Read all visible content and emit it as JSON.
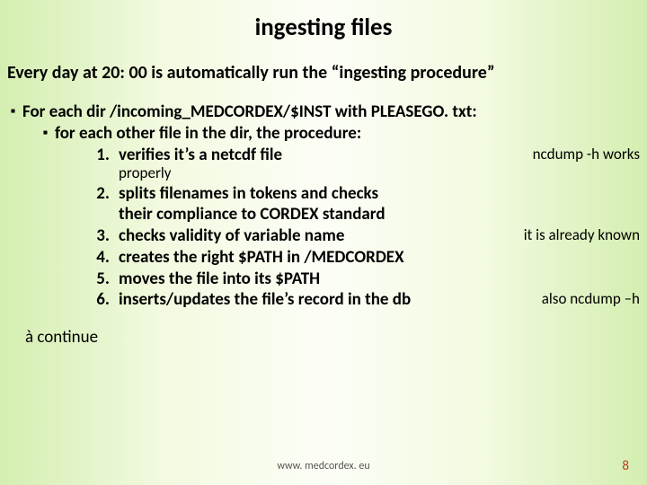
{
  "title": "ingesting files",
  "subtitle": "Every day at 20: 00 is automatically run the “ingesting procedure”",
  "bullet1": "For each dir /incoming_MEDCORDEX/$INST  with PLEASEGO. txt:",
  "bullet2": "for each other file in the dir, the procedure:",
  "items": [
    {
      "n": "1.",
      "text": "verifies it’s a netcdf file",
      "note": "ncdump -h works"
    },
    {
      "n": "2.",
      "text": "splits filenames in tokens and checks",
      "text2": "their compliance to CORDEX standard",
      "note": ""
    },
    {
      "n": "3.",
      "text": "checks validity of variable name",
      "note": "it is already known"
    },
    {
      "n": "4.",
      "text": "creates the right $PATH in /MEDCORDEX",
      "note": ""
    },
    {
      "n": "5.",
      "text": "moves the file into its $PATH",
      "note": ""
    },
    {
      "n": "6.",
      "text": "inserts/updates the file’s record in the db",
      "note": "also ncdump –h"
    }
  ],
  "properly": "properly",
  "continue": "à continue",
  "footer_url": "www. medcordex. eu",
  "page": "8",
  "square": "▪"
}
